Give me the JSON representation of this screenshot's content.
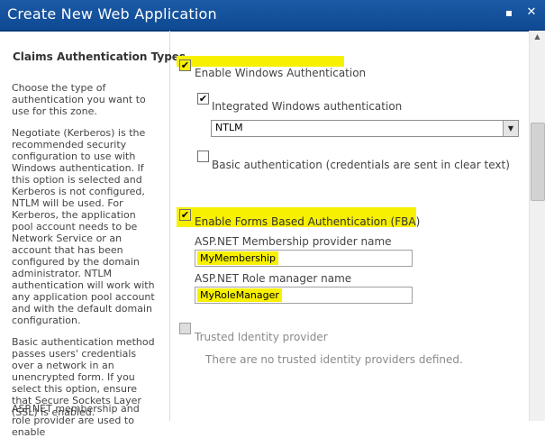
{
  "window": {
    "title": "Create New Web Application",
    "minimize_icon": "minimize-icon",
    "close_icon": "close-icon"
  },
  "section": {
    "title": "Claims Authentication Types",
    "paragraphs": [
      "Choose the type of authentication you want to use for this zone.",
      "Negotiate (Kerberos) is the recommended security configuration to use with Windows authentication. If this option is selected and Kerberos is not configured, NTLM will be used. For Kerberos, the application pool account needs to be Network Service or an account that has been configured by the domain administrator. NTLM authentication will work with any application pool account and with the default domain configuration.",
      "Basic authentication method passes users' credentials over a network in an unencrypted form. If you select this option, ensure that Secure Sockets Layer (SSL) is enabled.",
      "ASP.NET membership and role provider are used to enable"
    ]
  },
  "windows_auth": {
    "enable_label": "Enable Windows Authentication",
    "enabled_mark": "✔",
    "integrated_label": "Integrated Windows authentication",
    "integrated_mark": "✔",
    "integrated_selected": "NTLM",
    "basic_label": "Basic authentication (credentials are sent in clear text)"
  },
  "fba": {
    "enable_label": "Enable Forms Based Authentication (FBA)",
    "enabled_mark": "✔",
    "membership_label": "ASP.NET Membership provider name",
    "membership_value": "MyMembership",
    "role_label": "ASP.NET Role manager name",
    "role_value": "MyRoleManager"
  },
  "trusted": {
    "label": "Trusted Identity provider",
    "empty_message": "There are no trusted identity providers defined."
  },
  "colors": {
    "titlebar": "#1b5aa6",
    "highlight": "#f7f000"
  }
}
